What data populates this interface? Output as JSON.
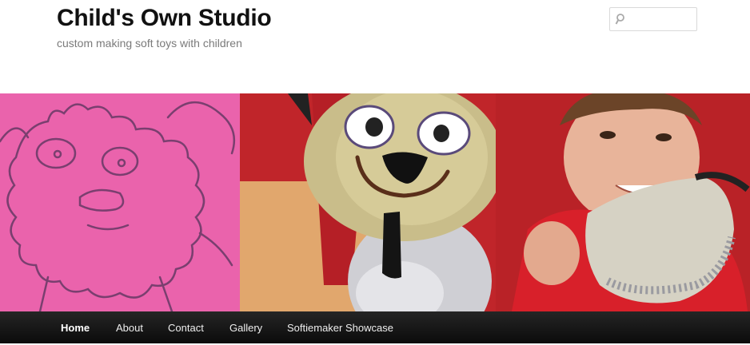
{
  "site": {
    "title": "Child's Own Studio",
    "description": "custom making soft toys with children"
  },
  "search": {
    "placeholder": "",
    "value": "",
    "icon": "search-icon"
  },
  "banner": {
    "panels": [
      "child-drawing",
      "plush-toy",
      "boy-with-toy"
    ],
    "colors": {
      "drawing_pink": "#e35aa6",
      "drawing_line": "#7a3f6f",
      "wall_red": "#c0252a",
      "shirt_red": "#d8202a"
    }
  },
  "nav": {
    "items": [
      {
        "label": "Home",
        "active": true
      },
      {
        "label": "About",
        "active": false
      },
      {
        "label": "Contact",
        "active": false
      },
      {
        "label": "Gallery",
        "active": false
      },
      {
        "label": "Softiemaker Showcase",
        "active": false
      }
    ]
  },
  "colors": {
    "nav_bg": "#1a1a1a",
    "title": "#111111",
    "tagline": "#7a7a7a"
  }
}
